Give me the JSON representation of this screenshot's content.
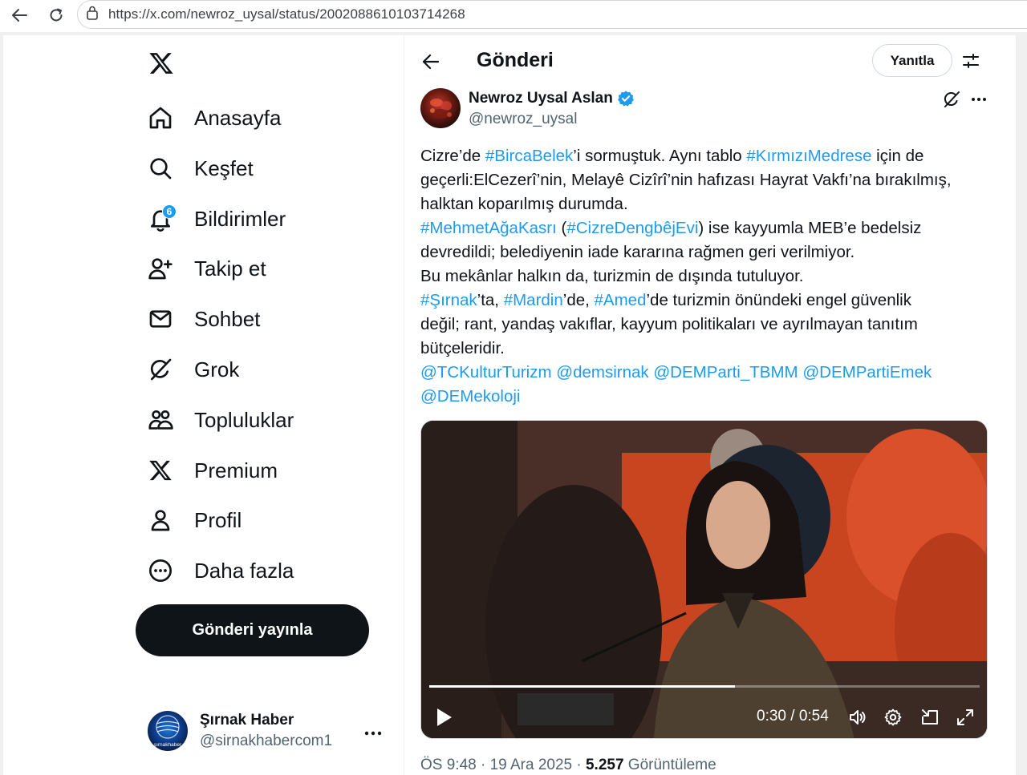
{
  "browser": {
    "url": "https://x.com/newroz_uysal/status/2002088610103714268"
  },
  "sidebar": {
    "logo_icon": "x-logo-icon",
    "items": [
      {
        "label": "Anasayfa",
        "icon": "home-icon"
      },
      {
        "label": "Keşfet",
        "icon": "search-icon"
      },
      {
        "label": "Bildirimler",
        "icon": "bell-icon",
        "badge": "6"
      },
      {
        "label": "Takip et",
        "icon": "person-add-icon"
      },
      {
        "label": "Sohbet",
        "icon": "mail-icon"
      },
      {
        "label": "Grok",
        "icon": "grok-icon"
      },
      {
        "label": "Topluluklar",
        "icon": "communities-icon"
      },
      {
        "label": "Premium",
        "icon": "x-logo-icon"
      },
      {
        "label": "Profil",
        "icon": "person-icon"
      },
      {
        "label": "Daha fazla",
        "icon": "more-circle-icon"
      }
    ],
    "post_button": "Gönderi yayınla",
    "account": {
      "name": "Şırnak Haber",
      "handle": "@sirnakhabercom1",
      "avatar_text": "şırnakhaber"
    }
  },
  "header": {
    "title": "Gönderi",
    "reply_button": "Yanıtla"
  },
  "tweet": {
    "author_name": "Newroz Uysal Aslan",
    "author_handle": "@newroz_uysal",
    "verified": true,
    "lines": [
      [
        {
          "t": "Cizre’de "
        },
        {
          "t": "#BircaBelek",
          "link": true
        },
        {
          "t": "’i sormuştuk. Aynı tablo "
        },
        {
          "t": "#KırmızıMedrese",
          "link": true
        },
        {
          "t": " için de"
        }
      ],
      [
        {
          "t": "geçerli:ElCezerî’nin, Melayê Cizîrî’nin hafızası Hayrat Vakfı’na bırakılmış,"
        }
      ],
      [
        {
          "t": "halktan koparılmış durumda."
        }
      ],
      [
        {
          "t": "#MehmetAğaKasrı",
          "link": true
        },
        {
          "t": " ("
        },
        {
          "t": "#CizreDengbêjEvi",
          "link": true
        },
        {
          "t": ") ise kayyumla MEB’e bedelsiz"
        }
      ],
      [
        {
          "t": "devredildi; belediyenin iade kararına rağmen geri verilmiyor."
        }
      ],
      [
        {
          "t": "Bu mekânlar halkın da, turizmin de dışında tutuluyor."
        }
      ],
      [
        {
          "t": "#Şırnak",
          "link": true
        },
        {
          "t": "’ta, "
        },
        {
          "t": "#Mardin",
          "link": true
        },
        {
          "t": "’de, "
        },
        {
          "t": "#Amed",
          "link": true
        },
        {
          "t": "’de turizmin önündeki engel güvenlik"
        }
      ],
      [
        {
          "t": "değil; rant, yandaş vakıflar, kayyum politikaları ve ayrılmayan tanıtım"
        }
      ],
      [
        {
          "t": "bütçeleridir."
        }
      ],
      [
        {
          "t": "@TCKulturTurizm",
          "link": true
        },
        {
          "t": " "
        },
        {
          "t": "@demsirnak",
          "link": true
        },
        {
          "t": " "
        },
        {
          "t": "@DEMParti_TBMM",
          "link": true
        },
        {
          "t": " "
        },
        {
          "t": "@DEMPartiEmek",
          "link": true
        }
      ],
      [
        {
          "t": "@DEMekoloji",
          "link": true
        }
      ]
    ],
    "video": {
      "time": "0:30 / 0:54",
      "progress_fraction": 0.556,
      "controls": [
        "play-icon",
        "volume-icon",
        "settings-gear-icon",
        "pip-icon",
        "fullscreen-icon"
      ]
    },
    "meta": {
      "time": "ÖS 9:48",
      "sep1": " · ",
      "date": "19 Ara 2025",
      "sep2": " · ",
      "views_count": "5.257",
      "views_label": " Görüntüleme"
    }
  },
  "colors": {
    "accent": "#1d9bf0",
    "text": "#0f1419",
    "muted": "#536471"
  }
}
